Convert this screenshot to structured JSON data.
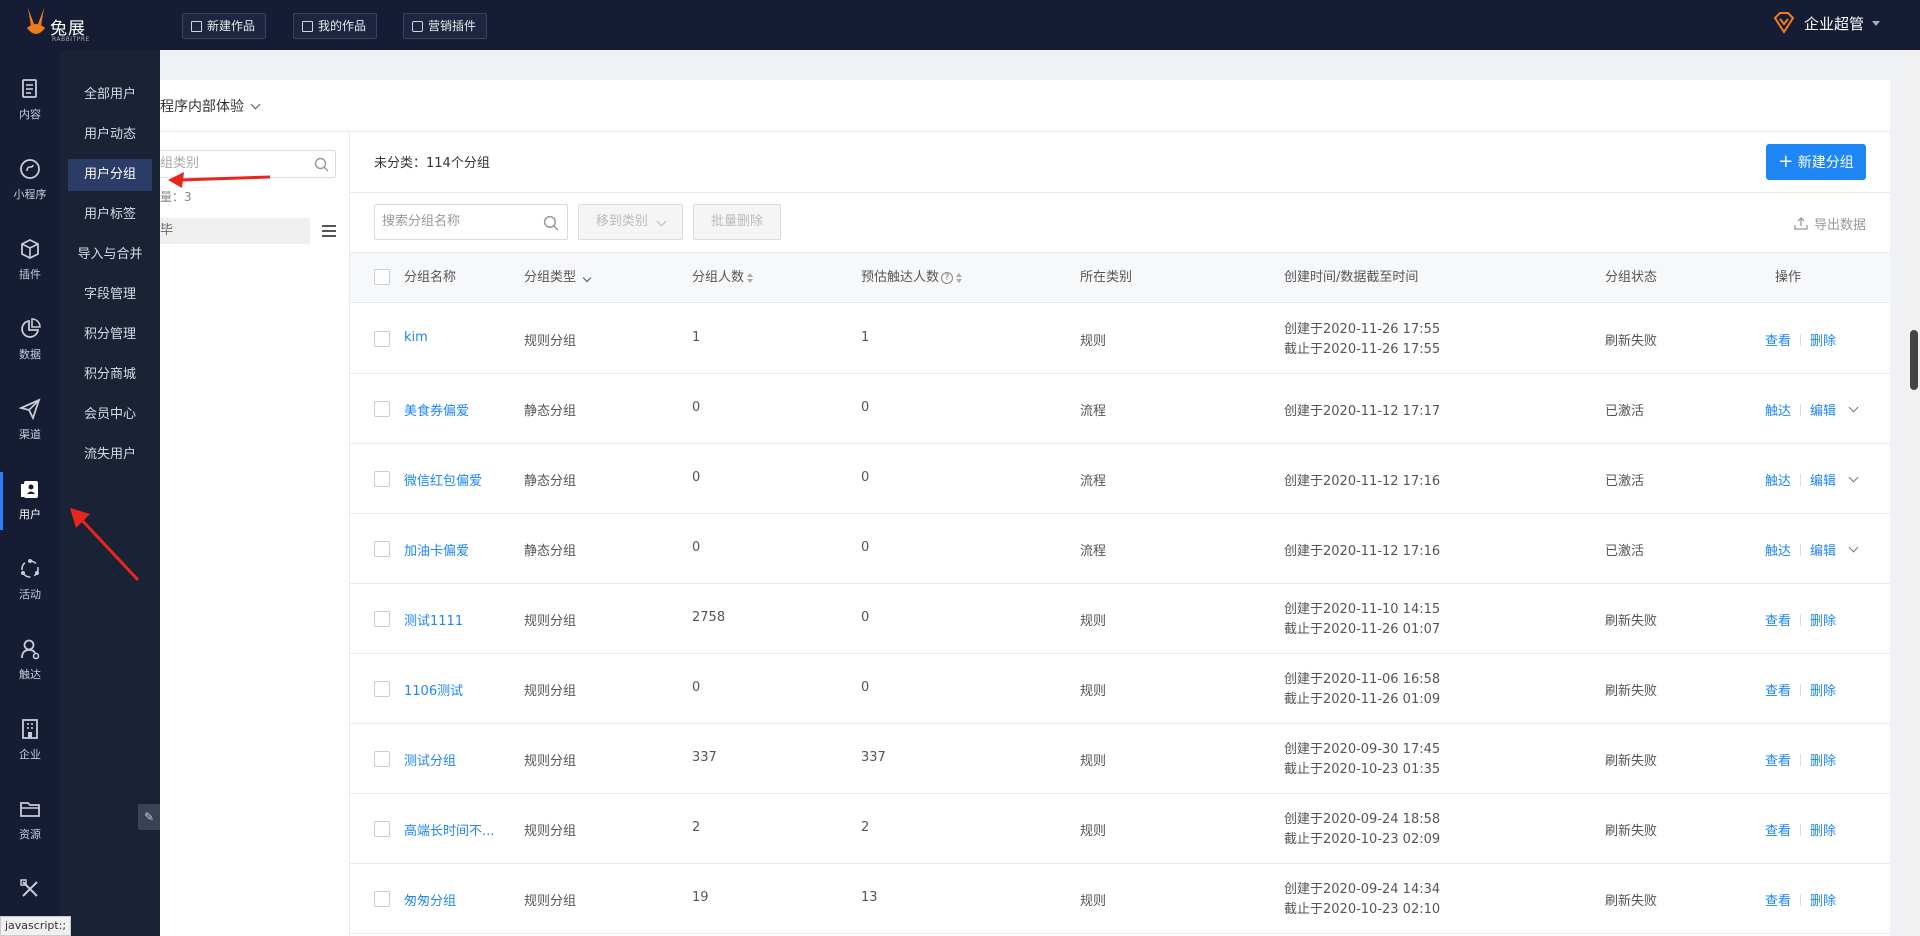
{
  "brand": {
    "name": "兔展",
    "sub": "RABBITPRE"
  },
  "topbar": {
    "buttons": [
      {
        "label": "新建作品",
        "icon": "plus-square-icon"
      },
      {
        "label": "我的作品",
        "icon": "list-icon"
      },
      {
        "label": "营销插件",
        "icon": "cube-icon"
      }
    ],
    "user": "企业超管"
  },
  "rail": [
    {
      "label": "内容",
      "icon": "document-icon"
    },
    {
      "label": "小程序",
      "icon": "miniprogram-icon"
    },
    {
      "label": "插件",
      "icon": "cube-icon"
    },
    {
      "label": "数据",
      "icon": "pie-chart-icon"
    },
    {
      "label": "渠道",
      "icon": "paper-plane-icon"
    },
    {
      "label": "用户",
      "icon": "user-card-icon",
      "active": true
    },
    {
      "label": "活动",
      "icon": "activity-icon"
    },
    {
      "label": "触达",
      "icon": "reach-icon"
    },
    {
      "label": "企业",
      "icon": "building-icon"
    },
    {
      "label": "资源",
      "icon": "folder-icon"
    },
    {
      "label": "",
      "icon": "tools-icon"
    }
  ],
  "flyout": [
    {
      "label": "全部用户"
    },
    {
      "label": "用户动态"
    },
    {
      "label": "用户分组",
      "active": true
    },
    {
      "label": "用户标签"
    },
    {
      "label": "导入与合并"
    },
    {
      "label": "字段管理"
    },
    {
      "label": "积分管理"
    },
    {
      "label": "积分商城"
    },
    {
      "label": "会员中心"
    },
    {
      "label": "流失用户"
    }
  ],
  "header": {
    "miniapp": "程序内部体验"
  },
  "category": {
    "search_placeholder": "组类别",
    "count_text": "量：3",
    "item": "毕"
  },
  "main": {
    "title": "未分类：114个分组",
    "new_group": "新建分组",
    "search_placeholder": "搜索分组名称",
    "move_btn": "移到类别",
    "batch_delete": "批量删除",
    "export": "导出数据"
  },
  "table": {
    "headers": {
      "name": "分组名称",
      "type": "分组类型",
      "count": "分组人数",
      "reach": "预估触达人数",
      "category": "所在类别",
      "time": "创建时间/数据截至时间",
      "status": "分组状态",
      "ops": "操作"
    },
    "rows": [
      {
        "name": "kim",
        "type": "规则分组",
        "count": "1",
        "reach": "1",
        "category": "规则",
        "created": "创建于2020-11-26 17:55",
        "until": "截止于2020-11-26 17:55",
        "status": "刷新失败",
        "op1": "查看",
        "op2": "删除"
      },
      {
        "name": "美食券偏爱",
        "type": "静态分组",
        "count": "0",
        "reach": "0",
        "category": "流程",
        "created": "创建于2020-11-12 17:17",
        "until": "",
        "status": "已激活",
        "op1": "触达",
        "op2": "编辑"
      },
      {
        "name": "微信红包偏爱",
        "type": "静态分组",
        "count": "0",
        "reach": "0",
        "category": "流程",
        "created": "创建于2020-11-12 17:16",
        "until": "",
        "status": "已激活",
        "op1": "触达",
        "op2": "编辑"
      },
      {
        "name": "加油卡偏爱",
        "type": "静态分组",
        "count": "0",
        "reach": "0",
        "category": "流程",
        "created": "创建于2020-11-12 17:16",
        "until": "",
        "status": "已激活",
        "op1": "触达",
        "op2": "编辑"
      },
      {
        "name": "测试1111",
        "type": "规则分组",
        "count": "2758",
        "reach": "0",
        "category": "规则",
        "created": "创建于2020-11-10 14:15",
        "until": "截止于2020-11-26 01:07",
        "status": "刷新失败",
        "op1": "查看",
        "op2": "删除"
      },
      {
        "name": "1106测试",
        "type": "规则分组",
        "count": "0",
        "reach": "0",
        "category": "规则",
        "created": "创建于2020-11-06 16:58",
        "until": "截止于2020-11-26 01:09",
        "status": "刷新失败",
        "op1": "查看",
        "op2": "删除"
      },
      {
        "name": "测试分组",
        "type": "规则分组",
        "count": "337",
        "reach": "337",
        "category": "规则",
        "created": "创建于2020-09-30 17:45",
        "until": "截止于2020-10-23 01:35",
        "status": "刷新失败",
        "op1": "查看",
        "op2": "删除"
      },
      {
        "name": "高端长时间不...",
        "type": "规则分组",
        "count": "2",
        "reach": "2",
        "category": "规则",
        "created": "创建于2020-09-24 18:58",
        "until": "截止于2020-10-23 02:09",
        "status": "刷新失败",
        "op1": "查看",
        "op2": "删除"
      },
      {
        "name": "匆匆分组",
        "type": "规则分组",
        "count": "19",
        "reach": "13",
        "category": "规则",
        "created": "创建于2020-09-24 14:34",
        "until": "截止于2020-10-23 02:10",
        "status": "刷新失败",
        "op1": "查看",
        "op2": "删除"
      }
    ]
  },
  "statusbar": "javascript:;",
  "colors": {
    "nav_bg": "#151c33",
    "accent": "#1f86f5",
    "annotation": "#e8261d"
  }
}
